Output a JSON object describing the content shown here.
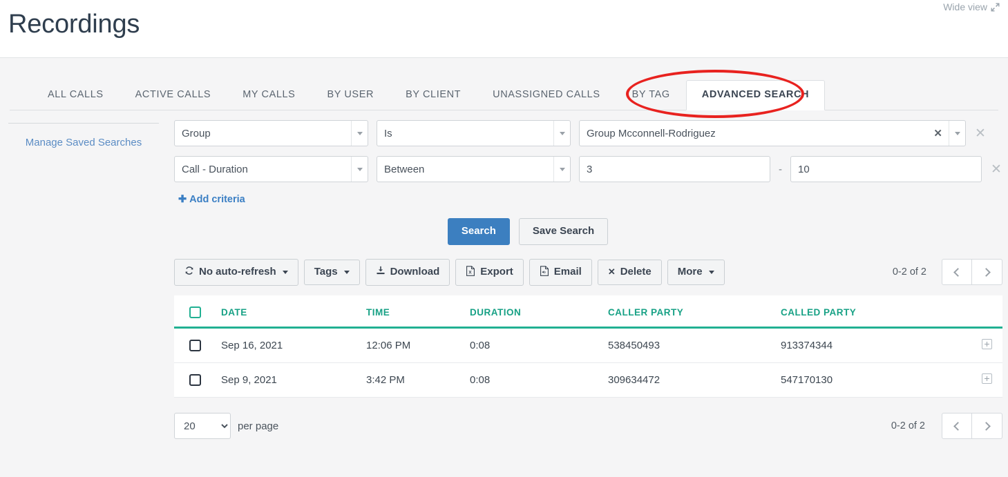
{
  "header": {
    "title": "Recordings",
    "wide_view_label": "Wide view",
    "wide_view_icon": "expand-diagonal-icon"
  },
  "tabs": [
    {
      "label": "ALL CALLS",
      "active": false
    },
    {
      "label": "ACTIVE CALLS",
      "active": false
    },
    {
      "label": "MY CALLS",
      "active": false
    },
    {
      "label": "BY USER",
      "active": false
    },
    {
      "label": "BY CLIENT",
      "active": false
    },
    {
      "label": "UNASSIGNED CALLS",
      "active": false
    },
    {
      "label": "BY TAG",
      "active": false
    },
    {
      "label": "ADVANCED SEARCH",
      "active": true
    }
  ],
  "sidebar": {
    "manage_saved_searches": "Manage Saved Searches"
  },
  "criteria": {
    "rows": [
      {
        "field": "Group",
        "operator": "Is",
        "value": "Group Mcconnell-Rodriguez",
        "clear_icon": "clear-x-icon",
        "remove_icon": "remove-row-icon"
      },
      {
        "field": "Call - Duration",
        "operator": "Between",
        "value_from": "3",
        "value_to": "10",
        "range_separator": "-",
        "remove_icon": "remove-row-icon"
      }
    ],
    "add_criteria_label": "Add criteria",
    "add_icon": "plus-icon"
  },
  "actions": {
    "search_label": "Search",
    "save_search_label": "Save Search"
  },
  "toolbar": {
    "auto_refresh_label": "No auto-refresh",
    "auto_refresh_icon": "refresh-icon",
    "tags_label": "Tags",
    "download_label": "Download",
    "download_icon": "download-icon",
    "export_label": "Export",
    "export_icon": "file-excel-icon",
    "email_label": "Email",
    "email_icon": "file-audio-icon",
    "delete_label": "Delete",
    "delete_icon": "x-icon",
    "more_label": "More",
    "page_count": "0-2 of 2",
    "prev_icon": "chevron-left-icon",
    "next_icon": "chevron-right-icon"
  },
  "table": {
    "columns": [
      "DATE",
      "TIME",
      "DURATION",
      "CALLER PARTY",
      "CALLED PARTY"
    ],
    "header_accent": "#21b092",
    "rows": [
      {
        "date": "Sep 16, 2021",
        "time": "12:06 PM",
        "duration": "0:08",
        "caller_party": "538450493",
        "called_party": "913374344"
      },
      {
        "date": "Sep 9, 2021",
        "time": "3:42 PM",
        "duration": "0:08",
        "caller_party": "309634472",
        "called_party": "547170130"
      }
    ]
  },
  "footer": {
    "per_page_value": "20",
    "per_page_label": "per page",
    "page_count": "0-2 of 2"
  },
  "annotation": {
    "shape": "ellipse",
    "color": "#e8221f",
    "targets": "ADVANCED SEARCH"
  }
}
